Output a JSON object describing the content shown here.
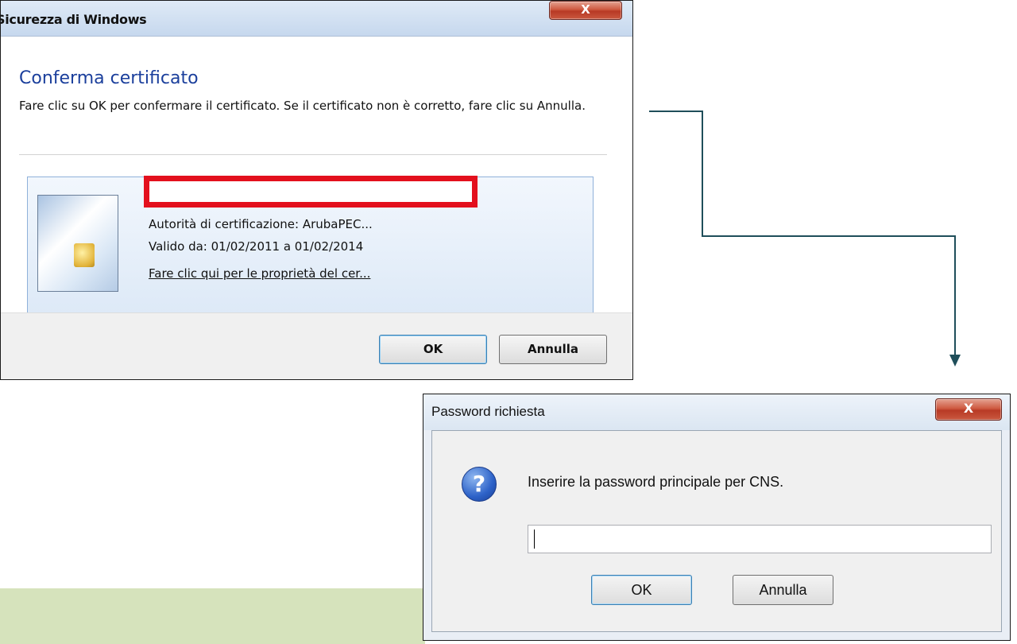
{
  "security_dialog": {
    "title": "Sicurezza di Windows",
    "close_label": "X",
    "heading": "Conferma certificato",
    "description": "Fare clic su OK per confermare il certificato. Se il certificato non è corretto, fare clic su Annulla.",
    "certificate": {
      "issuer": "Autorità di certificazione: ArubaPEC...",
      "validity": "Valido da: 01/02/2011 a 01/02/2014",
      "properties_link": "Fare clic qui per le proprietà del cer..."
    },
    "ok_label": "OK",
    "cancel_label": "Annulla"
  },
  "password_dialog": {
    "title": "Password richiesta",
    "close_label": "X",
    "icon": "question-icon",
    "prompt": "Inserire la password principale per CNS.",
    "password_value": "",
    "ok_label": "OK",
    "cancel_label": "Annulla"
  },
  "colors": {
    "redaction_border": "#e3101d",
    "connector": "#1f4e5a",
    "green_band": "#d6e3bc"
  }
}
